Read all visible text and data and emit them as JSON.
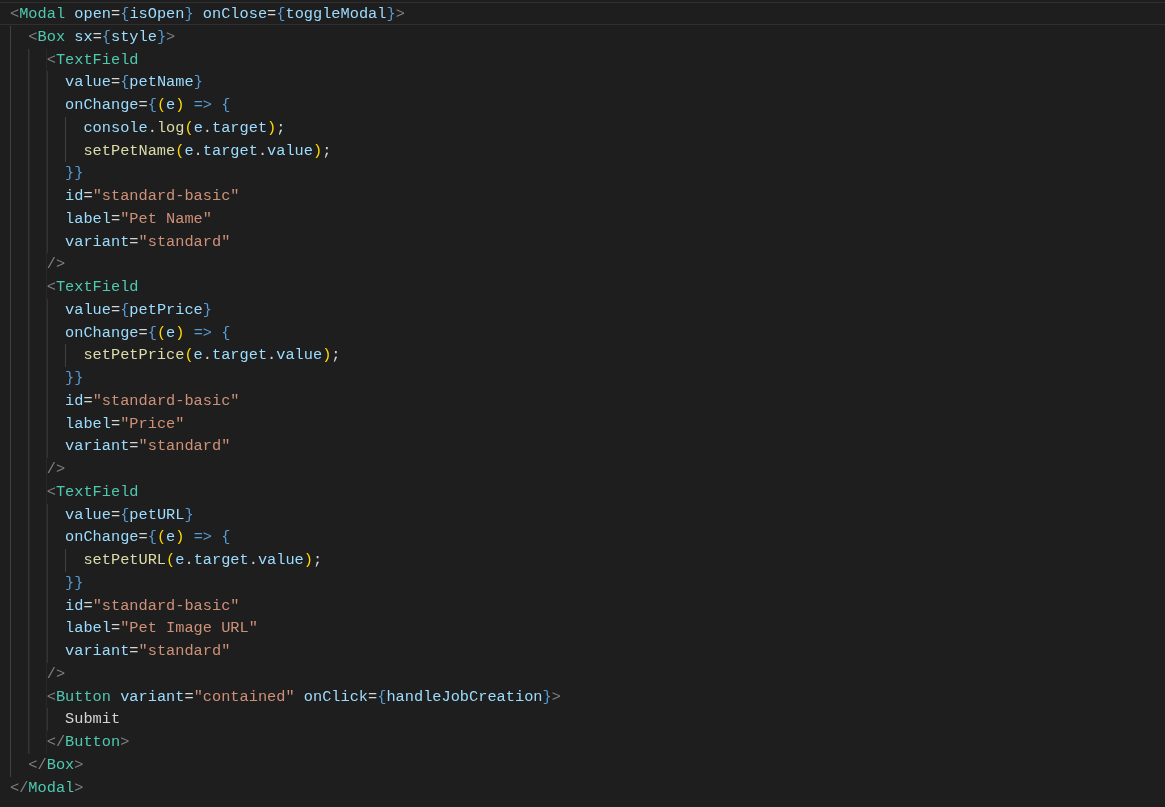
{
  "editor": {
    "lines": [
      {
        "current": true,
        "text": "<Modal open={isOpen} onClose={toggleModal}>"
      },
      {
        "current": false,
        "text": "  <Box sx={style}>"
      },
      {
        "current": false,
        "text": "    <TextField"
      },
      {
        "current": false,
        "text": "      value={petName}"
      },
      {
        "current": false,
        "text": "      onChange={(e) => {"
      },
      {
        "current": false,
        "text": "        console.log(e.target);"
      },
      {
        "current": false,
        "text": "        setPetName(e.target.value);"
      },
      {
        "current": false,
        "text": "      }}"
      },
      {
        "current": false,
        "text": "      id=\"standard-basic\""
      },
      {
        "current": false,
        "text": "      label=\"Pet Name\""
      },
      {
        "current": false,
        "text": "      variant=\"standard\""
      },
      {
        "current": false,
        "text": "    />"
      },
      {
        "current": false,
        "text": "    <TextField"
      },
      {
        "current": false,
        "text": "      value={petPrice}"
      },
      {
        "current": false,
        "text": "      onChange={(e) => {"
      },
      {
        "current": false,
        "text": "        setPetPrice(e.target.value);"
      },
      {
        "current": false,
        "text": "      }}"
      },
      {
        "current": false,
        "text": "      id=\"standard-basic\""
      },
      {
        "current": false,
        "text": "      label=\"Price\""
      },
      {
        "current": false,
        "text": "      variant=\"standard\""
      },
      {
        "current": false,
        "text": "    />"
      },
      {
        "current": false,
        "text": "    <TextField"
      },
      {
        "current": false,
        "text": "      value={petURL}"
      },
      {
        "current": false,
        "text": "      onChange={(e) => {"
      },
      {
        "current": false,
        "text": "        setPetURL(e.target.value);"
      },
      {
        "current": false,
        "text": "      }}"
      },
      {
        "current": false,
        "text": "      id=\"standard-basic\""
      },
      {
        "current": false,
        "text": "      label=\"Pet Image URL\""
      },
      {
        "current": false,
        "text": "      variant=\"standard\""
      },
      {
        "current": false,
        "text": "    />"
      },
      {
        "current": false,
        "text": "    <Button variant=\"contained\" onClick={handleJobCreation}>"
      },
      {
        "current": false,
        "text": "      Submit"
      },
      {
        "current": false,
        "text": "    </Button>"
      },
      {
        "current": false,
        "text": "  </Box>"
      },
      {
        "current": false,
        "text": "</Modal>"
      }
    ]
  }
}
